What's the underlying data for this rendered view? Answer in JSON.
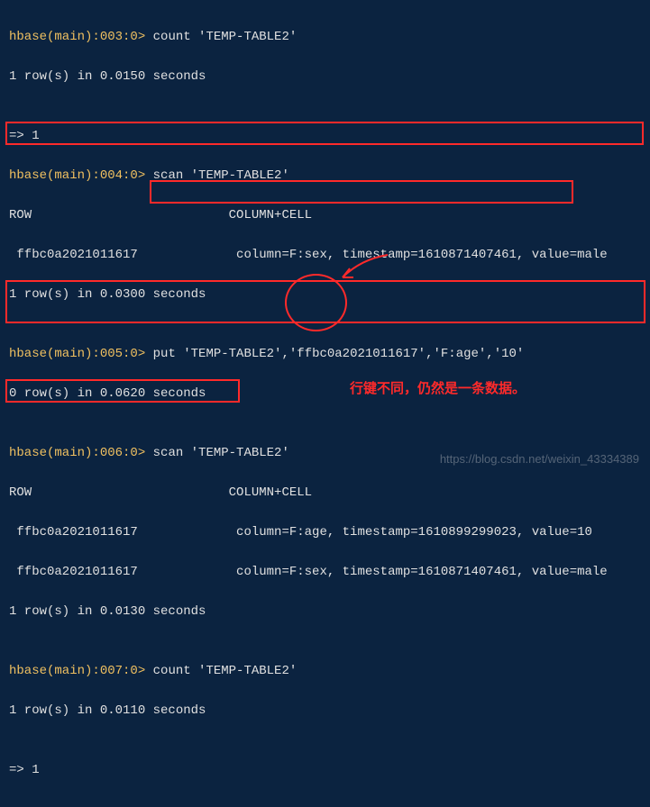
{
  "lines": {
    "l1_prompt": "hbase(main):003:0>",
    "l1_cmd": " count 'TEMP-TABLE2'",
    "l2": "1 row(s) in 0.0150 seconds",
    "blank": "",
    "l3": "=> 1",
    "l4_prompt": "hbase(main):004:0>",
    "l4_cmd": " scan 'TEMP-TABLE2'",
    "l5": "ROW                          COLUMN+CELL",
    "l6": " ffbc0a2021011617             column=F:sex, timestamp=1610871407461, value=male",
    "l7": "1 row(s) in 0.0300 seconds",
    "l8_prompt": "hbase(main):005:0>",
    "l8_cmd": " put 'TEMP-TABLE2','ffbc0a2021011617','F:age','10'",
    "l9": "0 row(s) in 0.0620 seconds",
    "l10_prompt": "hbase(main):006:0>",
    "l10_cmd": " scan 'TEMP-TABLE2'",
    "l11": "ROW                          COLUMN+CELL",
    "l12": " ffbc0a2021011617             column=F:age, timestamp=1610899299023, value=10",
    "l13": " ffbc0a2021011617             column=F:sex, timestamp=1610871407461, value=male",
    "l14": "1 row(s) in 0.0130 seconds",
    "l15_prompt": "hbase(main):007:0>",
    "l15_cmd": " count 'TEMP-TABLE2'",
    "l16": "1 row(s) in 0.0110 seconds",
    "l17": "=> 1"
  },
  "annotation_text": "行键不同，仍然是一条数据。",
  "watermark": "https://blog.csdn.net/weixin_43334389"
}
